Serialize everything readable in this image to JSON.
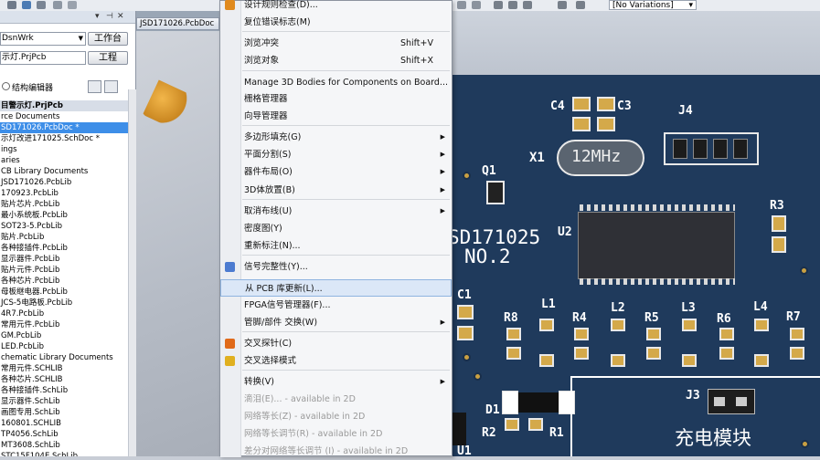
{
  "toolbar": {
    "variations": "[No Variations]"
  },
  "panel": {
    "workspace": "DsnWrk",
    "project_file": "示灯.PrjPcb",
    "btn_workspace": "工作台",
    "btn_project": "工程",
    "radio_structure": "结构编辑器",
    "tree": [
      "目警示灯.PrjPcb",
      "rce Documents",
      "SD171026.PcbDoc *",
      "示灯改进171025.SchDoc *",
      "ings",
      "aries",
      "CB Library Documents",
      "JSD171026.PcbLib",
      "170923.PcbLib",
      "贴片芯片.PcbLib",
      "最小系统板.PcbLib",
      "SOT23-5.PcbLib",
      "贴片.PcbLib",
      "各种接插件.PcbLib",
      "显示器件.PcbLib",
      "贴片元件.PcbLib",
      "各种芯片.PcbLib",
      "母板继电器.PcbLib",
      "JCS-5电路板.PcbLib",
      "4R7.PcbLib",
      "常用元件.PcbLib",
      "GM.PcbLib",
      "LED.PcbLib",
      "chematic Library Documents",
      "常用元件.SCHLIB",
      "各种芯片.SCHLIB",
      "各种接插件.SchLib",
      "显示器件.SchLib",
      "画图专用.SchLib",
      "160801.SCHLIB",
      "TP4056.SchLib",
      "MT3608.SchLib",
      "STC15F104E.SchLib",
      "GM.SchLib"
    ]
  },
  "doc_tab": "JSD171026.PcbDoc",
  "menu": {
    "items": [
      {
        "label": "设计规则检查(D)...",
        "shortcut": "",
        "sub": false,
        "disabled": false
      },
      {
        "label": "复位错误标志(M)",
        "shortcut": "",
        "sub": false,
        "disabled": false
      },
      {
        "label": "浏览冲突",
        "shortcut": "Shift+V",
        "sub": false,
        "disabled": false
      },
      {
        "label": "浏览对象",
        "shortcut": "Shift+X",
        "sub": false,
        "disabled": false
      },
      {
        "label": "Manage 3D Bodies for Components on Board...",
        "shortcut": "",
        "sub": false,
        "disabled": false
      },
      {
        "label": "栅格管理器",
        "shortcut": "",
        "sub": false,
        "disabled": false
      },
      {
        "label": "向导管理器",
        "shortcut": "",
        "sub": false,
        "disabled": false
      },
      {
        "label": "多边形填充(G)",
        "shortcut": "",
        "sub": true,
        "disabled": false
      },
      {
        "label": "平面分割(S)",
        "shortcut": "",
        "sub": true,
        "disabled": false
      },
      {
        "label": "器件布局(O)",
        "shortcut": "",
        "sub": true,
        "disabled": false
      },
      {
        "label": "3D体放置(B)",
        "shortcut": "",
        "sub": true,
        "disabled": false
      },
      {
        "label": "取消布线(U)",
        "shortcut": "",
        "sub": true,
        "disabled": false
      },
      {
        "label": "密度图(Y)",
        "shortcut": "",
        "sub": false,
        "disabled": false
      },
      {
        "label": "重新标注(N)...",
        "shortcut": "",
        "sub": false,
        "disabled": false
      },
      {
        "label": "信号完整性(Y)...",
        "shortcut": "",
        "sub": false,
        "disabled": false
      },
      {
        "label": "从 PCB 库更新(L)...",
        "shortcut": "",
        "sub": false,
        "disabled": false
      },
      {
        "label": "FPGA信号管理器(F)...",
        "shortcut": "",
        "sub": false,
        "disabled": false
      },
      {
        "label": "管脚/部件 交换(W)",
        "shortcut": "",
        "sub": true,
        "disabled": false
      },
      {
        "label": "交叉探针(C)",
        "shortcut": "",
        "sub": false,
        "disabled": false
      },
      {
        "label": "交叉选择模式",
        "shortcut": "",
        "sub": false,
        "disabled": false
      },
      {
        "label": "转换(V)",
        "shortcut": "",
        "sub": true,
        "disabled": false
      },
      {
        "label": "滴泪(E)... - available in 2D",
        "shortcut": "",
        "sub": false,
        "disabled": true
      },
      {
        "label": "网络等长(Z) - available in 2D",
        "shortcut": "",
        "sub": false,
        "disabled": true
      },
      {
        "label": "网络等长调节(R) - available in 2D",
        "shortcut": "",
        "sub": false,
        "disabled": true
      },
      {
        "label": "差分对网络等长调节 (I) - available in 2D",
        "shortcut": "",
        "sub": false,
        "disabled": true
      }
    ]
  },
  "pcb": {
    "labels": {
      "c4": "C4",
      "c3": "C3",
      "j4": "J4",
      "x1": "X1",
      "q1": "Q1",
      "crystal": "12MHz",
      "r3": "R3",
      "u2": "U2",
      "board_name": "SD171025",
      "board_no": "NO.2",
      "c1": "C1",
      "l1": "L1",
      "l2": "L2",
      "l3": "L3",
      "l4": "L4",
      "r8": "R8",
      "r4": "R4",
      "r5": "R5",
      "r6": "R6",
      "r7": "R7",
      "d1": "D1",
      "j3": "J3",
      "r2": "R2",
      "r1": "R1",
      "u1": "U1",
      "module": "充电模块"
    }
  }
}
